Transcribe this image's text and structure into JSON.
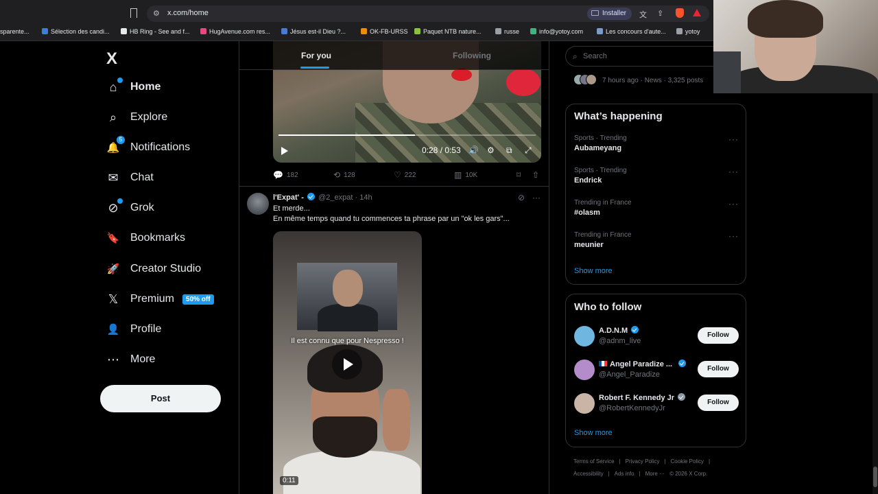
{
  "browser": {
    "url": "x.com/home",
    "install_label": "Installer",
    "bookmarks": [
      {
        "label": "sparente...",
        "color": "#1f1f22"
      },
      {
        "label": "Sélection des candi...",
        "color": "#3b7dd8"
      },
      {
        "label": "HB Ring - See and f...",
        "color": "#e7e9ea"
      },
      {
        "label": "HugAvenue.com res...",
        "color": "#e64980"
      },
      {
        "label": "Jésus est-il Dieu ?...",
        "color": "#4a7bd0"
      },
      {
        "label": "OK-FB-URSS",
        "color": "#f08c00"
      },
      {
        "label": "Paquet NTB nature...",
        "color": "#8fbf3f"
      },
      {
        "label": "russe",
        "color": "#9aa0a6"
      },
      {
        "label": "info@yotoy.com",
        "color": "#3fb37f"
      },
      {
        "label": "Les concours d'aute...",
        "color": "#7a9cc6"
      },
      {
        "label": "yotoy",
        "color": "#9aa0a6"
      }
    ]
  },
  "nav": {
    "logo": "X",
    "items": [
      {
        "label": "Home",
        "icon": "home-icon",
        "glyph": "⌂",
        "bold": true,
        "dot": true
      },
      {
        "label": "Explore",
        "icon": "search-icon",
        "glyph": "⌕"
      },
      {
        "label": "Notifications",
        "icon": "bell-icon",
        "glyph": "🔔",
        "badge": "5"
      },
      {
        "label": "Chat",
        "icon": "mail-icon",
        "glyph": "✉"
      },
      {
        "label": "Grok",
        "icon": "grok-icon",
        "glyph": "⊘",
        "dot": true
      },
      {
        "label": "Bookmarks",
        "icon": "bookmark-icon",
        "glyph": "🔖"
      },
      {
        "label": "Creator Studio",
        "icon": "rocket-icon",
        "glyph": "🚀"
      },
      {
        "label": "Premium",
        "icon": "x-premium-icon",
        "glyph": "𝕏",
        "badge_text": "50% off"
      },
      {
        "label": "Profile",
        "icon": "person-icon",
        "glyph": "👤"
      },
      {
        "label": "More",
        "icon": "more-icon",
        "glyph": "⋯"
      }
    ],
    "post_label": "Post"
  },
  "timeline": {
    "tabs": [
      {
        "label": "For you",
        "active": true
      },
      {
        "label": "Following",
        "active": false
      }
    ],
    "video1": {
      "time": "0:28 / 0:53",
      "progress": 0.53
    },
    "post1_actions": {
      "replies": "182",
      "reposts": "128",
      "likes": "222",
      "views": "10K"
    },
    "post2": {
      "name": "l'Expat' -",
      "handle": "@2_expat",
      "time": "14h",
      "line1": "Et merde...",
      "line2": "En même temps quand tu commences ta phrase par un \"ok les gars\"...",
      "video_caption": "Il est connu que pour Nespresso !",
      "video_time": "0:11"
    }
  },
  "sidebar": {
    "search_placeholder": "Search",
    "news_meta": "7 hours ago · News · 3,325 posts",
    "happening_title": "What’s happening",
    "trends": [
      {
        "meta": "Sports · Trending",
        "name": "Aubameyang"
      },
      {
        "meta": "Sports · Trending",
        "name": "Endrick"
      },
      {
        "meta": "Trending in France",
        "name": "#olasm"
      },
      {
        "meta": "Trending in France",
        "name": "meunier"
      }
    ],
    "show_more": "Show more",
    "who_title": "Who to follow",
    "follows": [
      {
        "name": "A.D.N.M",
        "handle": "@adnm_live",
        "avatar_color": "#6fb6e0",
        "flag": false
      },
      {
        "name": "Angel Paradize ...",
        "handle": "@Angel_Paradize",
        "avatar_color": "#b38cc9",
        "flag": true
      },
      {
        "name": "Robert F. Kennedy Jr",
        "handle": "@RobertKennedyJr",
        "avatar_color": "#c9b4a5",
        "flag": false
      }
    ],
    "follow_label": "Follow",
    "footer1": [
      "Terms of Service",
      "|",
      "Privacy Policy",
      "|",
      "Cookie Policy",
      "|"
    ],
    "footer2": [
      "Accessibility",
      "|",
      "Ads info",
      "|",
      "More ···",
      "© 2026 X Corp."
    ]
  }
}
